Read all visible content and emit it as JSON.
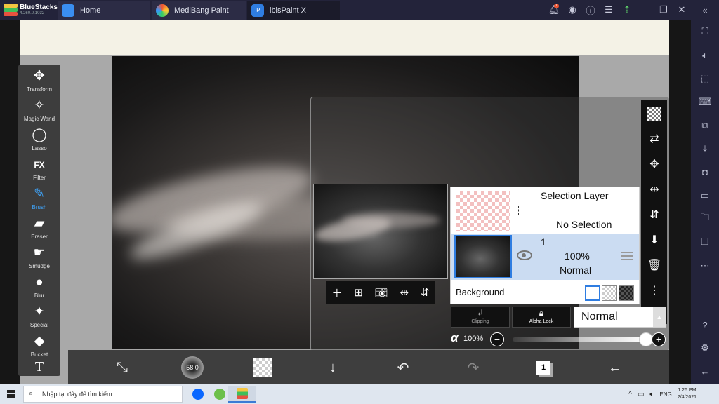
{
  "emulator": {
    "brand": "BlueStacks",
    "version": "4.260.0.1032",
    "tabs": [
      {
        "label": "Home",
        "active": false
      },
      {
        "label": "MediBang Paint",
        "active": false
      },
      {
        "label": "ibisPaint X",
        "active": true
      }
    ],
    "notification_count": "1",
    "side_icons": [
      "fullscreen-icon",
      "volume-icon",
      "pointer-icon",
      "keyboard-icon",
      "install-apk-icon",
      "download-icon",
      "screenshot-icon",
      "record-icon",
      "folder-icon",
      "multi-instance-icon",
      "more-icon",
      "help-icon",
      "settings-icon",
      "back-icon"
    ]
  },
  "tools": [
    {
      "label": "Transform",
      "icon": "move-icon",
      "glyph": "✥",
      "active": false
    },
    {
      "label": "Magic Wand",
      "icon": "magic-wand-icon",
      "glyph": "✧",
      "active": false
    },
    {
      "label": "Lasso",
      "icon": "lasso-icon",
      "glyph": "◯",
      "active": false
    },
    {
      "label": "Filter",
      "icon": "fx-icon",
      "glyph": "FX",
      "active": false
    },
    {
      "label": "Brush",
      "icon": "brush-icon",
      "glyph": "✎",
      "active": true
    },
    {
      "label": "Eraser",
      "icon": "eraser-icon",
      "glyph": "▰",
      "active": false
    },
    {
      "label": "Smudge",
      "icon": "smudge-icon",
      "glyph": "☛",
      "active": false
    },
    {
      "label": "Blur",
      "icon": "blur-drop-icon",
      "glyph": "●",
      "active": false
    },
    {
      "label": "Special",
      "icon": "special-icon",
      "glyph": "✦",
      "active": false
    },
    {
      "label": "Bucket",
      "icon": "bucket-icon",
      "glyph": "◆",
      "active": false
    },
    {
      "label": "",
      "icon": "text-icon",
      "glyph": "T",
      "active": false
    }
  ],
  "bottom_toolbar": {
    "brush_size": "58.0",
    "layer_count": "1"
  },
  "layers_panel": {
    "selection_layer": {
      "title": "Selection Layer",
      "status": "No Selection"
    },
    "layer": {
      "number": "1",
      "opacity": "100%",
      "blend": "Normal",
      "visible": true
    },
    "background_label": "Background",
    "clipping_label": "Clipping",
    "alpha_lock_label": "Alpha Lock",
    "blend_mode": "Normal",
    "alpha_symbol": "α",
    "opacity_label": "100%",
    "opacity_value": 1.0
  },
  "taskbar": {
    "search_placeholder": "Nhập tại đây để tìm kiếm",
    "language": "ENG",
    "time": "1:26 PM",
    "date": "2/4/2021"
  },
  "colors": {
    "accent_blue": "#3fa7ff",
    "selected_layer_bg": "#cbdcf2",
    "selection_checker": "#f3c0c0"
  }
}
